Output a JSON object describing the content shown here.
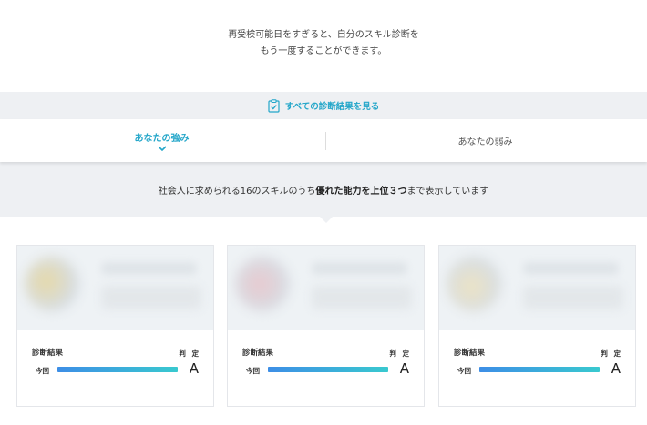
{
  "intro": {
    "line1": "再受検可能日をすぎると、自分のスキル診断を",
    "line2": "もう一度することができます。"
  },
  "all_results": {
    "label": "すべての診断結果を見る",
    "icon": "clipboard-check-icon"
  },
  "tabs": [
    {
      "label": "あなたの強み",
      "active": true
    },
    {
      "label": "あなたの弱み",
      "active": false
    }
  ],
  "description": {
    "pre": "社会人に求められる16のスキルのうち",
    "bold": "優れた能力を上位３つ",
    "post": "まで表示しています"
  },
  "cards": [
    {
      "result_label": "診断結果",
      "judge_label": "判 定",
      "now_label": "今回",
      "progress": 1.0,
      "grade": "A"
    },
    {
      "result_label": "診断結果",
      "judge_label": "判 定",
      "now_label": "今回",
      "progress": 1.0,
      "grade": "A"
    },
    {
      "result_label": "診断結果",
      "judge_label": "判 定",
      "now_label": "今回",
      "progress": 1.0,
      "grade": "A"
    }
  ],
  "colors": {
    "accent": "#23a6c9",
    "band_bg": "#eef0f3",
    "bar_start": "#3d8ee6",
    "bar_end": "#39c9cf"
  }
}
